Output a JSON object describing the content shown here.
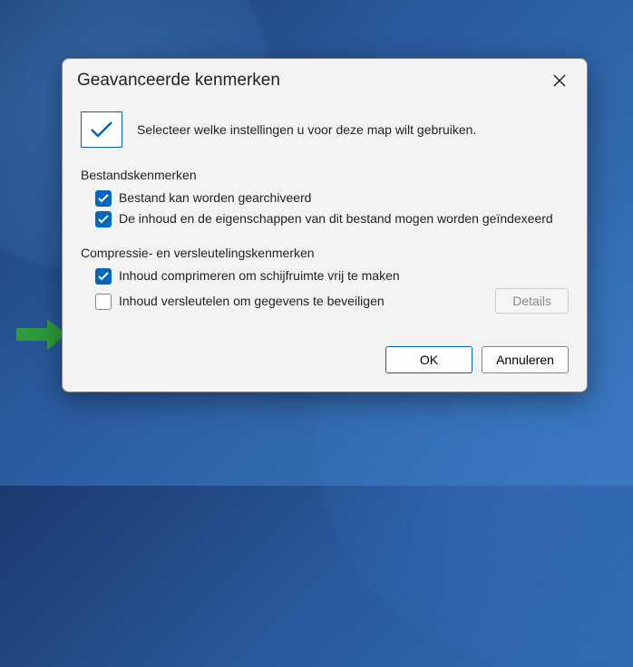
{
  "dialog": {
    "title": "Geavanceerde kenmerken",
    "prompt": "Selecteer welke instellingen u voor deze map wilt gebruiken.",
    "group1_label": "Bestandskenmerken",
    "opt_archive": "Bestand kan worden gearchiveerd",
    "opt_index": "De inhoud en de eigenschappen van dit bestand mogen worden geïndexeerd",
    "group2_label": "Compressie- en versleutelingskenmerken",
    "opt_compress": "Inhoud comprimeren om schijfruimte vrij te maken",
    "opt_encrypt": "Inhoud versleutelen om gegevens te beveiligen",
    "details_btn": "Details",
    "ok_btn": "OK",
    "cancel_btn": "Annuleren"
  }
}
